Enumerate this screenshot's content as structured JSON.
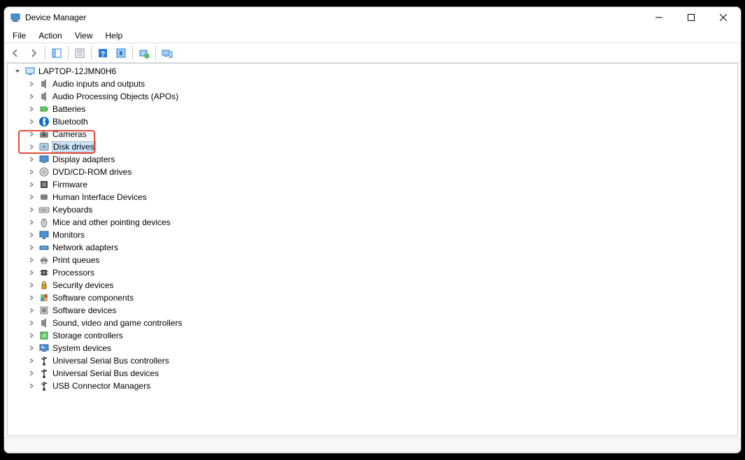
{
  "window": {
    "title": "Device Manager"
  },
  "menus": [
    "File",
    "Action",
    "View",
    "Help"
  ],
  "tree": {
    "root": "LAPTOP-12JMN0H6",
    "selected": "Disk drives",
    "items": [
      {
        "label": "Audio inputs and outputs",
        "icon": "audio"
      },
      {
        "label": "Audio Processing Objects (APOs)",
        "icon": "audio"
      },
      {
        "label": "Batteries",
        "icon": "battery"
      },
      {
        "label": "Bluetooth",
        "icon": "bluetooth"
      },
      {
        "label": "Cameras",
        "icon": "camera"
      },
      {
        "label": "Disk drives",
        "icon": "disk"
      },
      {
        "label": "Display adapters",
        "icon": "display"
      },
      {
        "label": "DVD/CD-ROM drives",
        "icon": "dvd"
      },
      {
        "label": "Firmware",
        "icon": "firmware"
      },
      {
        "label": "Human Interface Devices",
        "icon": "hid"
      },
      {
        "label": "Keyboards",
        "icon": "keyboard"
      },
      {
        "label": "Mice and other pointing devices",
        "icon": "mouse"
      },
      {
        "label": "Monitors",
        "icon": "monitor"
      },
      {
        "label": "Network adapters",
        "icon": "network"
      },
      {
        "label": "Print queues",
        "icon": "printer"
      },
      {
        "label": "Processors",
        "icon": "cpu"
      },
      {
        "label": "Security devices",
        "icon": "security"
      },
      {
        "label": "Software components",
        "icon": "software"
      },
      {
        "label": "Software devices",
        "icon": "software2"
      },
      {
        "label": "Sound, video and game controllers",
        "icon": "audio"
      },
      {
        "label": "Storage controllers",
        "icon": "storage"
      },
      {
        "label": "System devices",
        "icon": "system"
      },
      {
        "label": "Universal Serial Bus controllers",
        "icon": "usb"
      },
      {
        "label": "Universal Serial Bus devices",
        "icon": "usb"
      },
      {
        "label": "USB Connector Managers",
        "icon": "usb"
      }
    ]
  }
}
